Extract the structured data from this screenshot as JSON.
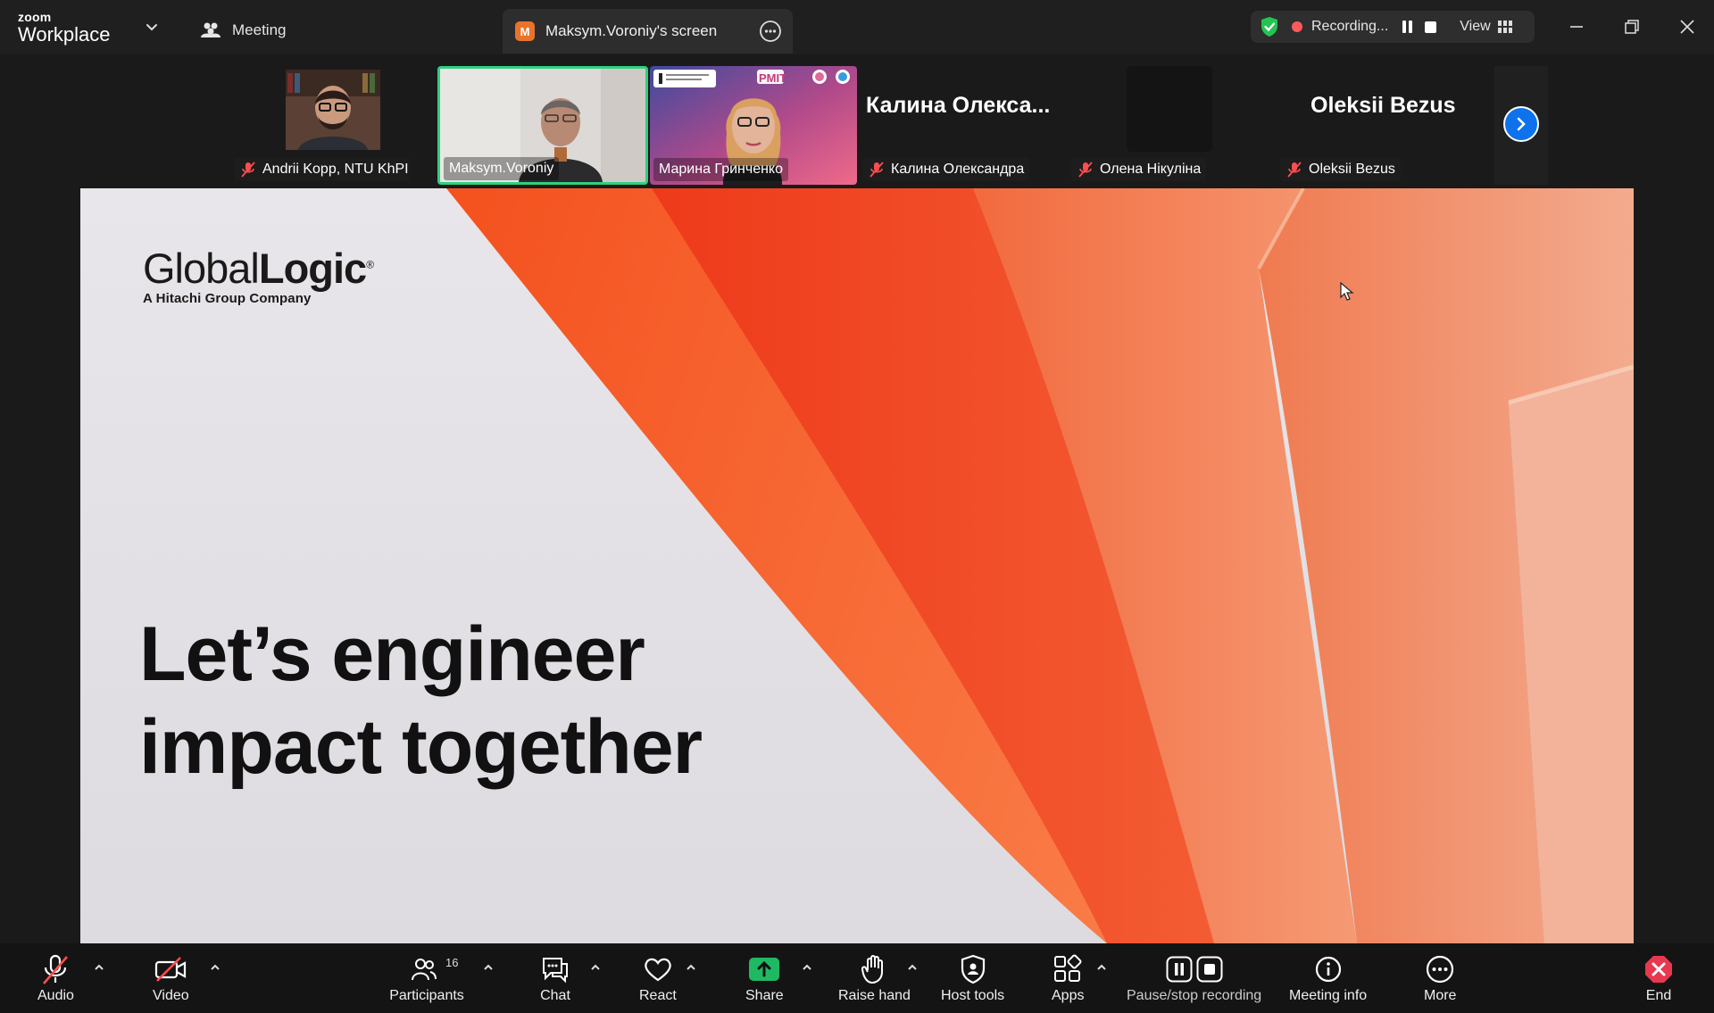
{
  "app": {
    "brand_top": "zoom",
    "brand_bottom": "Workplace"
  },
  "header": {
    "meeting_tab": "Meeting",
    "screen_tab": {
      "badge": "M",
      "label": "Maksym.Voroniy's screen"
    },
    "recording": {
      "label": "Recording...",
      "view_label": "View"
    }
  },
  "participants": [
    {
      "name": "Andrii Kopp, NTU KhPI",
      "muted": true
    },
    {
      "name": "Maksym.Voroniy",
      "muted": false
    },
    {
      "name": "Марина Гринченко",
      "muted": false
    },
    {
      "name": "Калина Олександра",
      "display": "Калина  Олекса...",
      "muted": true
    },
    {
      "name": "Олена Нікуліна",
      "muted": true
    },
    {
      "name": "Oleksii Bezus",
      "display": "Oleksii Bezus",
      "muted": true
    }
  ],
  "tile_overlay": {
    "pmit": "PMIT"
  },
  "slide": {
    "logo_light": "Global",
    "logo_bold": "Logic",
    "logo_reg": "®",
    "logo_sub": "A Hitachi Group Company",
    "headline_line1": "Let’s engineer",
    "headline_line2": "impact together"
  },
  "toolbar": {
    "audio": "Audio",
    "video": "Video",
    "participants": "Participants",
    "participants_count": "16",
    "chat": "Chat",
    "react": "React",
    "share": "Share",
    "raise_hand": "Raise hand",
    "host_tools": "Host tools",
    "apps": "Apps",
    "pause_stop": "Pause/stop recording",
    "meeting_info": "Meeting info",
    "more": "More",
    "end": "End"
  },
  "colors": {
    "accent_blue": "#0e72ed",
    "active_speaker": "#2fd07f",
    "share_green": "#1fb964",
    "end_red": "#e8384f",
    "slide_orange": "#f4511e"
  }
}
